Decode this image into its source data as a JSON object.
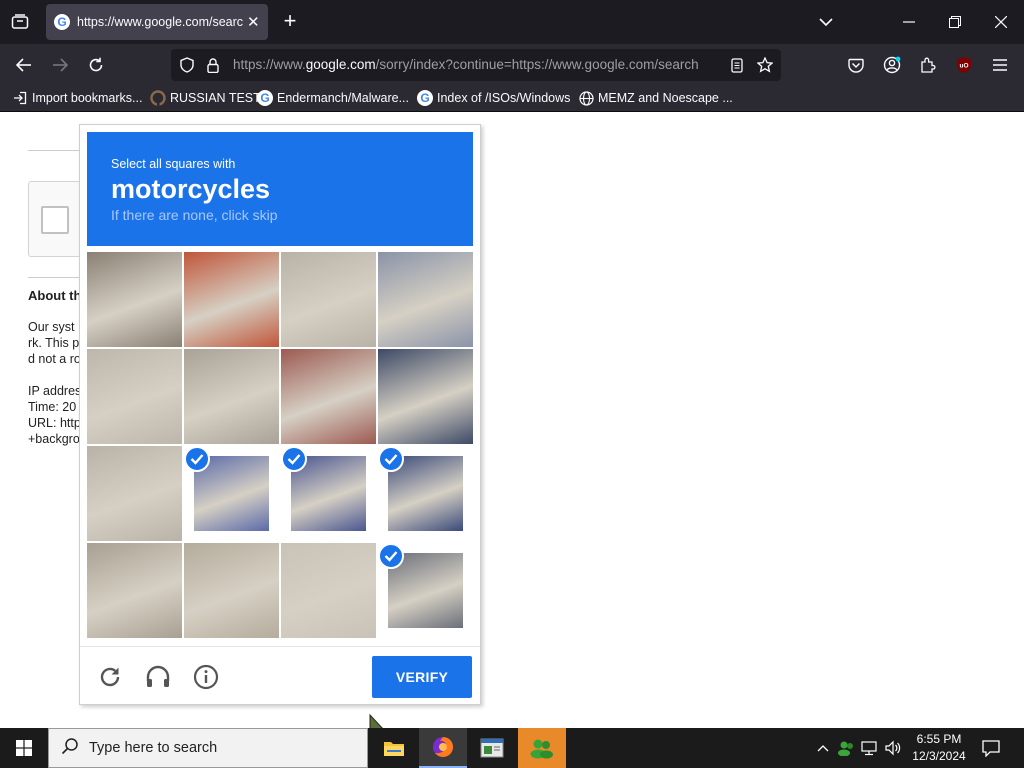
{
  "browser": {
    "tab_title": "https://www.google.com/search",
    "tab_list_icon": "tab-list-icon",
    "url_prefix": "https://www.",
    "url_host": "google.com",
    "url_rest": "/sorry/index?continue=https://www.google.com/search",
    "bookmarks": [
      {
        "label": "Import bookmarks...",
        "icon": "import-icon"
      },
      {
        "label": "RUSSIAN TEST",
        "icon": "site-icon"
      },
      {
        "label": "Endermanch/Malware...",
        "icon": "google-icon"
      },
      {
        "label": "Index of /ISOs/Windows",
        "icon": "google-icon"
      },
      {
        "label": "MEMZ and Noescape ...",
        "icon": "globe-icon"
      }
    ]
  },
  "page": {
    "about_title": "About th",
    "body_lines": [
      "Our syst",
      "rk. This p",
      "d not a ro",
      "IP addres",
      "Time: 20",
      "URL: http",
      "+backgro"
    ]
  },
  "captcha": {
    "instruction": "Select all squares with",
    "target": "motorcycles",
    "hint": "If there are none, click skip",
    "verify_label": "VERIFY",
    "tiles_selected": [
      false,
      false,
      false,
      false,
      false,
      false,
      false,
      false,
      false,
      true,
      true,
      true,
      false,
      false,
      false,
      true
    ],
    "footer_icons": [
      "reload-icon",
      "audio-icon",
      "info-icon"
    ]
  },
  "taskbar": {
    "search_placeholder": "Type here to search",
    "time": "6:55 PM",
    "date": "12/3/2024"
  },
  "colors": {
    "accent_blue": "#1a73e8",
    "chrome_dark": "#1c1b22",
    "toolbar": "#2b2a33"
  }
}
